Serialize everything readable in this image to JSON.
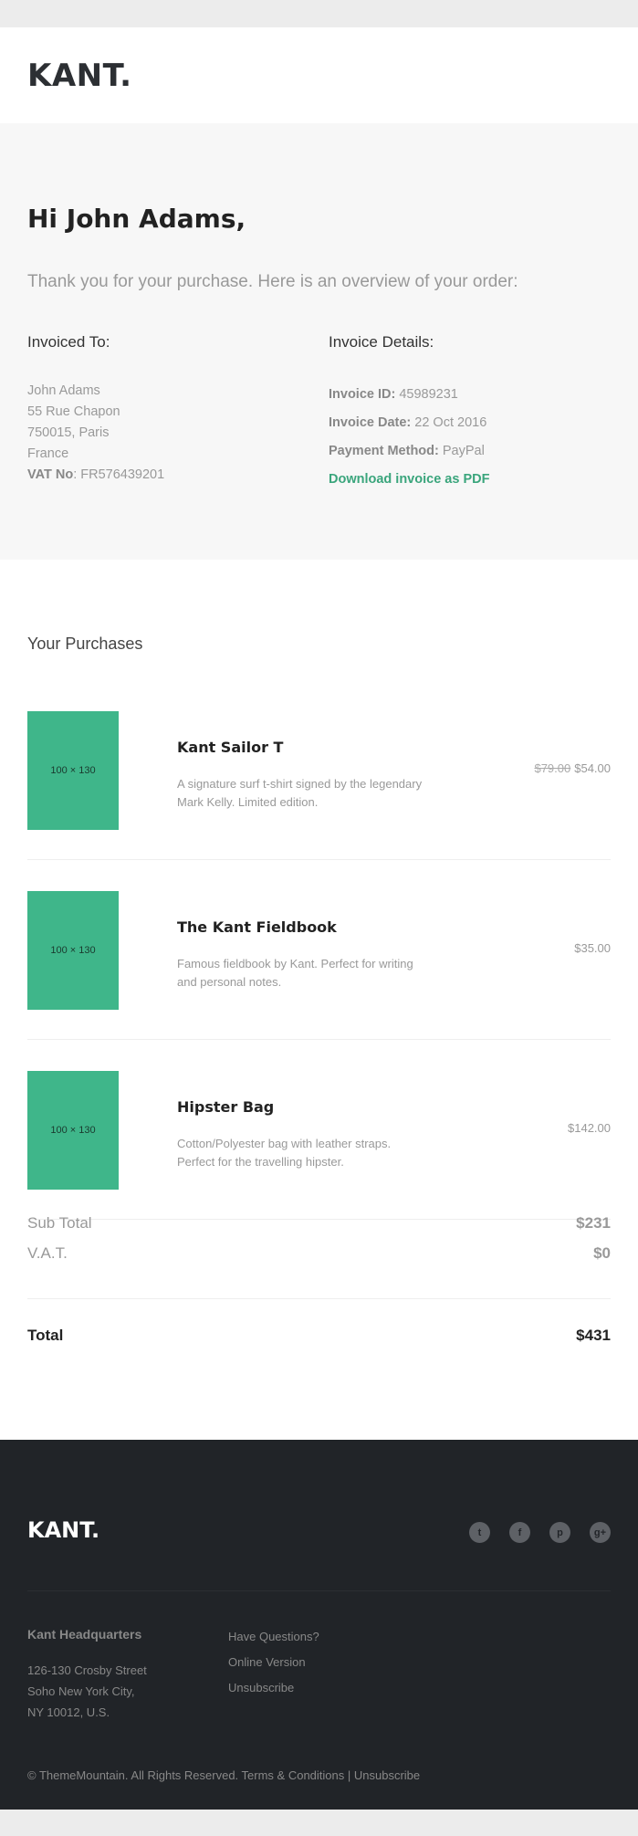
{
  "header": {
    "logo": "KANT."
  },
  "intro": {
    "greeting": "Hi John Adams,",
    "thanks": "Thank you for your purchase. Here is an overview of your order:",
    "invoiced_to": {
      "title": "Invoiced To:",
      "lines": [
        "John Adams",
        "55 Rue Chapon",
        "750015, Paris",
        "France"
      ],
      "vat_label": "VAT No",
      "vat_value": ": FR576439201"
    },
    "invoice_details": {
      "title": "Invoice Details:",
      "id_label": "Invoice ID:",
      "id_value": " 45989231",
      "date_label": "Invoice Date:",
      "date_value": " 22 Oct 2016",
      "payment_label": "Payment Method:",
      "payment_value": " PayPal",
      "pdf_link": "Download invoice as PDF"
    }
  },
  "purchases": {
    "title": "Your Purchases",
    "items": [
      {
        "thumb": "100 × 130",
        "name": "Kant Sailor T",
        "desc": "A signature surf t-shirt signed by the legendary Mark Kelly. Limited edition.",
        "old_price": "$79.00",
        "price": "$54.00"
      },
      {
        "thumb": "100 × 130",
        "name": "The Kant Fieldbook",
        "desc": "Famous fieldbook by Kant. Perfect for writing and personal notes.",
        "old_price": "",
        "price": "$35.00"
      },
      {
        "thumb": "100 × 130",
        "name": "Hipster Bag",
        "desc": "Cotton/Polyester bag with leather straps. Perfect for the travelling hipster.",
        "old_price": "",
        "price": "$142.00"
      }
    ],
    "subtotal_label": "Sub Total",
    "subtotal_value": "$231",
    "vat_label": "V.A.T.",
    "vat_value": "$0",
    "total_label": "Total",
    "total_value": "$431"
  },
  "footer": {
    "logo": "KANT.",
    "socials": [
      {
        "icon": "twitter-icon",
        "glyph": "t"
      },
      {
        "icon": "facebook-icon",
        "glyph": "f"
      },
      {
        "icon": "pinterest-icon",
        "glyph": "p"
      },
      {
        "icon": "googleplus-icon",
        "glyph": "g+"
      }
    ],
    "hq_title": "Kant Headquarters",
    "hq_lines": [
      "126-130 Crosby Street",
      "Soho New York City,",
      "NY 10012, U.S."
    ],
    "links": [
      "Have Questions?",
      "Online Version",
      "Unsubscribe"
    ],
    "copyright_text": "© ThemeMountain. All Rights Reserved. ",
    "terms_link": "Terms & Conditions",
    "separator": " | ",
    "unsubscribe_link": "Unsubscribe"
  },
  "colors": {
    "accent": "#3aa57c",
    "thumb": "#3fb68a",
    "footer_bg": "#212428"
  }
}
